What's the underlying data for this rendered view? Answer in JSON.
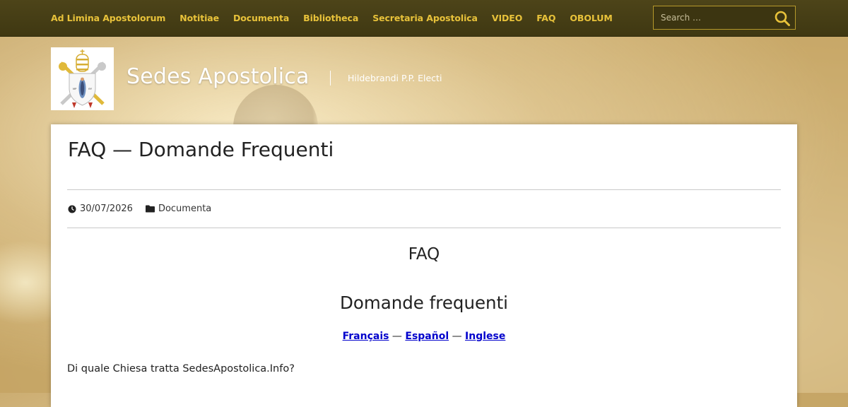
{
  "nav": {
    "items": [
      "Ad Limina Apostolorum",
      "Notitiae",
      "Documenta",
      "Bibliotheca",
      "Secretaria Apostolica",
      "VIDEO",
      "FAQ",
      "OBOLUM"
    ],
    "search_placeholder": "Search …"
  },
  "site": {
    "title": "Sedes Apostolica",
    "tagline": "Hildebrandi P.P. Electi"
  },
  "post": {
    "title": "FAQ — Domande Frequenti",
    "date": "30/07/2026",
    "category": "Documenta",
    "heading1": "FAQ",
    "heading2": "Domande frequenti",
    "languages": [
      "Français",
      "Español",
      "Inglese"
    ],
    "lang_sep": " — ",
    "question": "Di quale Chiesa tratta SedesApostolica.Info?"
  },
  "colors": {
    "nav_bg": "#4d4419",
    "nav_link": "#e8c23a",
    "search_border": "#b69a2b",
    "link_blue": "#0000cc"
  }
}
